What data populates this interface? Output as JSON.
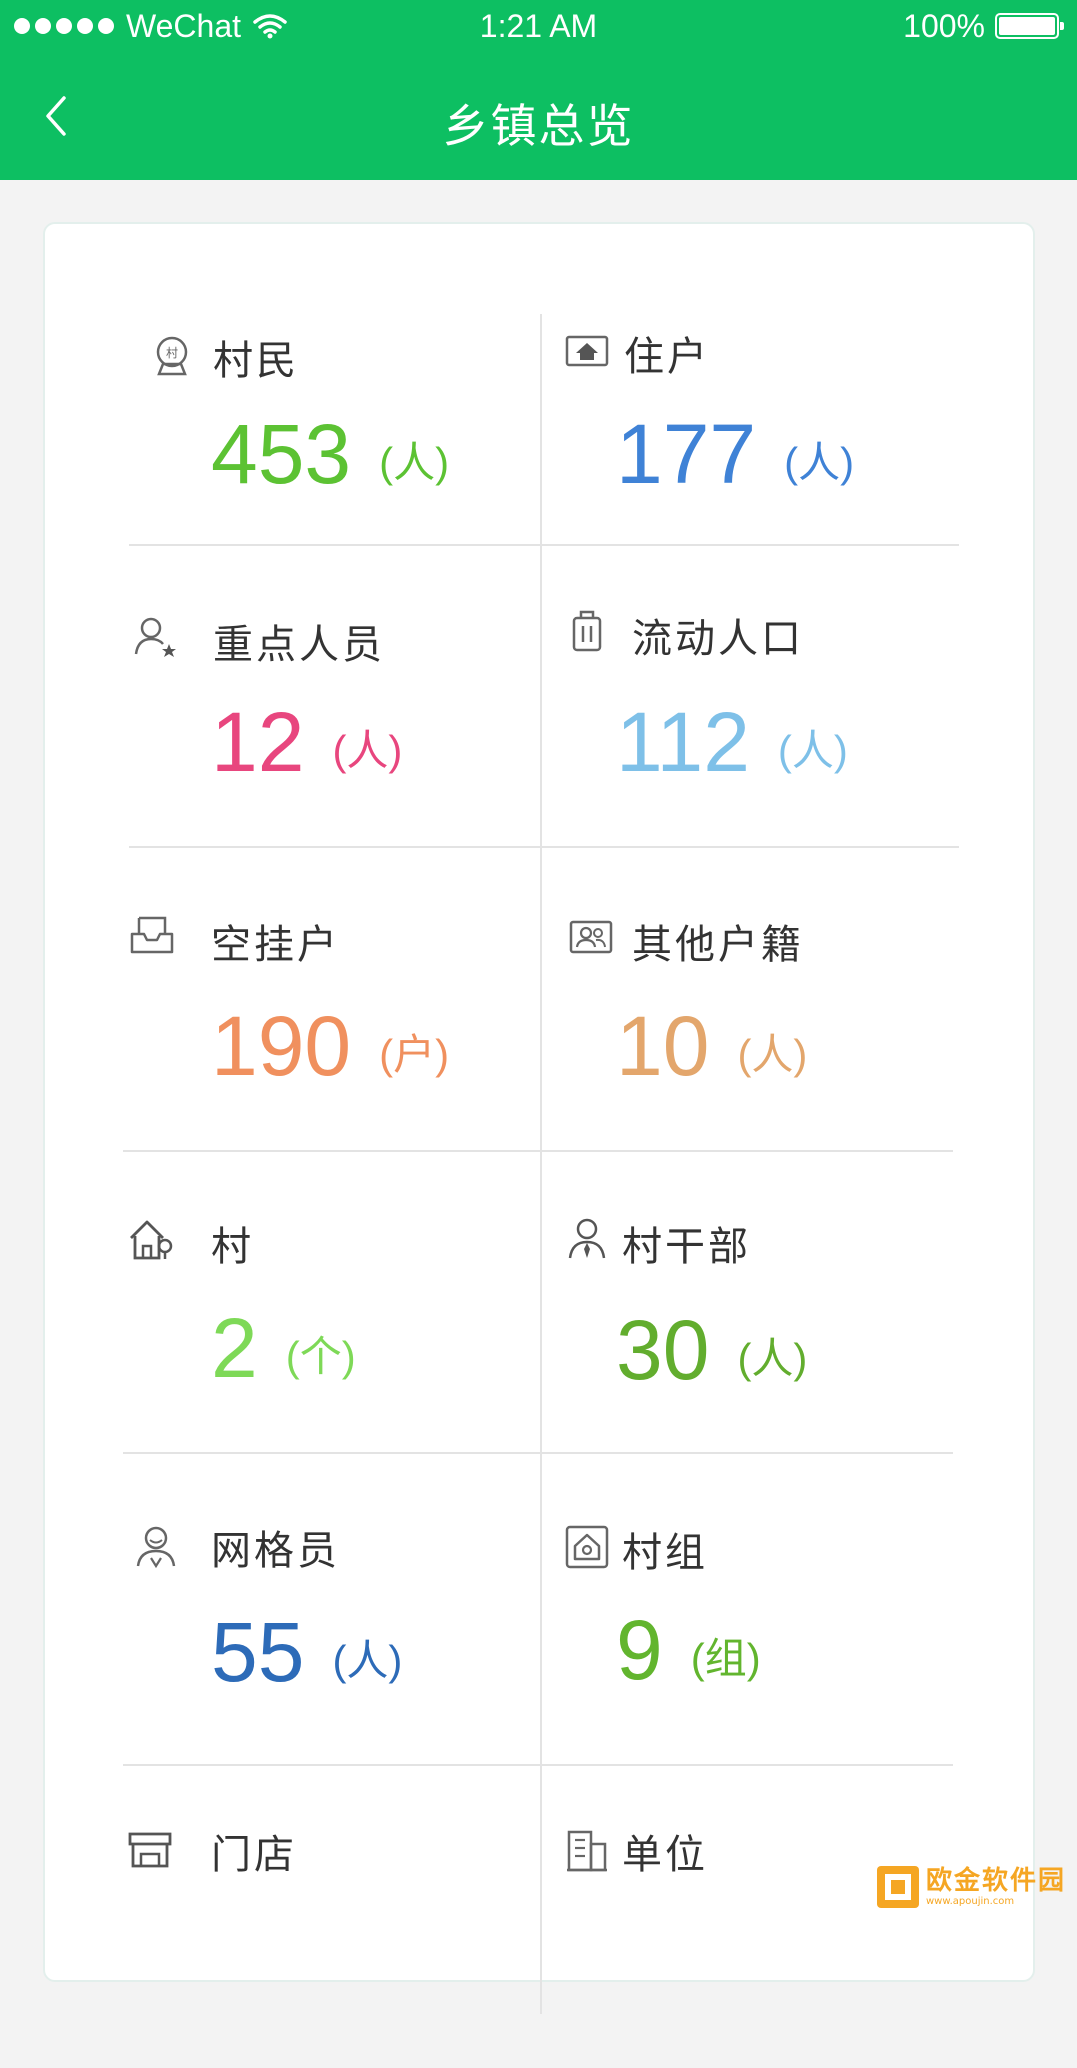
{
  "status_bar": {
    "carrier": "WeChat",
    "time": "1:21 AM",
    "battery": "100%"
  },
  "nav": {
    "title": "乡镇总览"
  },
  "stats": [
    {
      "id": "villagers",
      "label": "村民",
      "value": "453",
      "unit": "(人)",
      "color": "#5cc233",
      "icon": "village-seal-icon"
    },
    {
      "id": "households",
      "label": "住户",
      "value": "177",
      "unit": "(人)",
      "color": "#3f82d6",
      "icon": "house-sign-icon"
    },
    {
      "id": "key-persons",
      "label": "重点人员",
      "value": "12",
      "unit": "(人)",
      "color": "#e8467e",
      "icon": "user-star-icon"
    },
    {
      "id": "floating-population",
      "label": "流动人口",
      "value": "112",
      "unit": "(人)",
      "color": "#7ec0e8",
      "icon": "luggage-icon"
    },
    {
      "id": "vacant-households",
      "label": "空挂户",
      "value": "190",
      "unit": "(户)",
      "color": "#f0905e",
      "icon": "inbox-icon"
    },
    {
      "id": "other-registry",
      "label": "其他户籍",
      "value": "10",
      "unit": "(人)",
      "color": "#e3a66c",
      "icon": "id-card-icon"
    },
    {
      "id": "villages",
      "label": "村",
      "value": "2",
      "unit": "(个)",
      "color": "#7ed957",
      "icon": "village-house-icon"
    },
    {
      "id": "village-cadres",
      "label": "村干部",
      "value": "30",
      "unit": "(人)",
      "color": "#62ad2e",
      "icon": "user-tie-icon"
    },
    {
      "id": "grid-workers",
      "label": "网格员",
      "value": "55",
      "unit": "(人)",
      "color": "#2d6bb8",
      "icon": "user-badge-icon"
    },
    {
      "id": "village-groups",
      "label": "村组",
      "value": "9",
      "unit": "(组)",
      "color": "#62b52e",
      "icon": "home-frame-icon"
    },
    {
      "id": "stores",
      "label": "门店",
      "value": "",
      "unit": "",
      "color": "#333333",
      "icon": "store-icon"
    },
    {
      "id": "units",
      "label": "单位",
      "value": "",
      "unit": "",
      "color": "#333333",
      "icon": "building-icon"
    }
  ],
  "watermark": {
    "text": "欧金软件园",
    "url_text": "www.apoujin.com"
  }
}
